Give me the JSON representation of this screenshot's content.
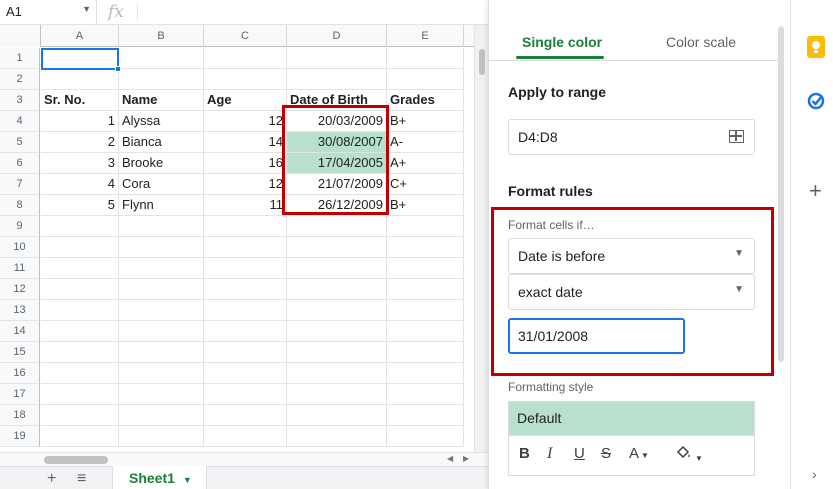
{
  "formula_bar": {
    "name_box": "A1",
    "fx_label": "fx"
  },
  "columns": [
    "A",
    "B",
    "C",
    "D",
    "E"
  ],
  "rows": [
    "1",
    "2",
    "3",
    "4",
    "5",
    "6",
    "7",
    "8",
    "9",
    "10",
    "11",
    "12",
    "13",
    "14",
    "15",
    "16",
    "17",
    "18",
    "19"
  ],
  "table": {
    "headers": [
      "Sr. No.",
      "Name",
      "Age",
      "Date of Birth",
      "Grades"
    ],
    "data": [
      [
        "1",
        "Alyssa",
        "12",
        "20/03/2009",
        "B+"
      ],
      [
        "2",
        "Bianca",
        "14",
        "30/08/2007",
        "A-"
      ],
      [
        "3",
        "Brooke",
        "16",
        "17/04/2005",
        "A+"
      ],
      [
        "4",
        "Cora",
        "12",
        "21/07/2009",
        "C+"
      ],
      [
        "5",
        "Flynn",
        "11",
        "26/12/2009",
        "B+"
      ]
    ]
  },
  "sheet_tabs": {
    "add": "+",
    "list": "≡",
    "active": "Sheet1"
  },
  "panel": {
    "tab_single": "Single color",
    "tab_scale": "Color scale",
    "apply_to_range_label": "Apply to range",
    "range_value": "D4:D8",
    "format_rules_label": "Format rules",
    "format_cells_if_label": "Format cells if…",
    "condition": "Date is before",
    "date_option": "exact date",
    "date_value": "31/01/2008",
    "formatting_style_label": "Formatting style",
    "style_preview": "Default",
    "toolbar": {
      "bold": "B",
      "italic": "I",
      "underline": "U",
      "strike": "S",
      "text_color": "A"
    }
  },
  "colors": {
    "highlight": "#b7e1cd",
    "accent_green": "#188038",
    "focus_blue": "#1a73e8",
    "annotation_red": "#c00000"
  },
  "icons": [
    "keep-icon",
    "tasks-icon",
    "add-icon",
    "expand-icon",
    "grid-icon",
    "fill-color-icon",
    "dropdown-icon"
  ]
}
